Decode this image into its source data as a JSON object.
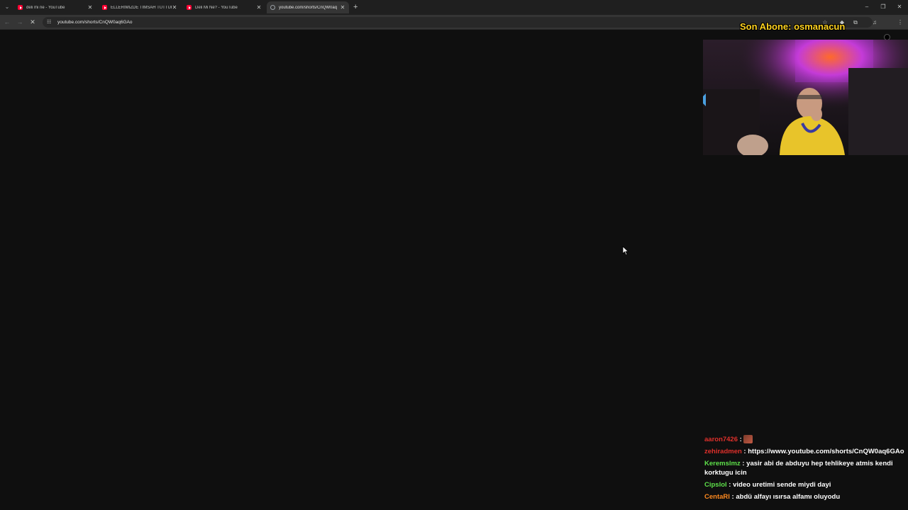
{
  "browser": {
    "tabs": [
      {
        "title": "deli mi ne - YouTube",
        "favicon": "youtube-icon",
        "active": false
      },
      {
        "title": "ELLERİMİZDE TİMSAH TUTTUK",
        "favicon": "youtube-icon",
        "active": false
      },
      {
        "title": "Deli Mi Ne? - YouTube",
        "favicon": "youtube-icon",
        "active": false
      },
      {
        "title": "youtube.com/shorts/CnQW0aq",
        "favicon": "globe-icon",
        "active": true
      }
    ],
    "url": "youtube.com/shorts/CnQW0aq6GAo"
  },
  "overlay": {
    "title": "Son Abone: osmanacun",
    "title_color": "#ffd21f"
  },
  "chat": {
    "messages": [
      {
        "user": "aaron7426",
        "user_color": "#e0302b",
        "sep": " : ",
        "text": "",
        "emote": "emote-icon"
      },
      {
        "user": "zehiradmen",
        "user_color": "#e0302b",
        "sep": " : ",
        "text": "https://www.youtube.com/shorts/CnQW0aq6GAo"
      },
      {
        "user": "Keremslmz",
        "user_color": "#5ee04a",
        "sep": " : ",
        "text": "yasir abi de abduyu hep tehlikeye atmis kendi korktugu icin"
      },
      {
        "user": "Cipslol",
        "user_color": "#5ee04a",
        "sep": " : ",
        "text": "video uretimi sende miydi dayi"
      },
      {
        "user": "CentaRl",
        "user_color": "#ff8a1f",
        "sep": " : ",
        "text": "abdü alfayı ısırsa alfamı oluyodu"
      }
    ]
  }
}
